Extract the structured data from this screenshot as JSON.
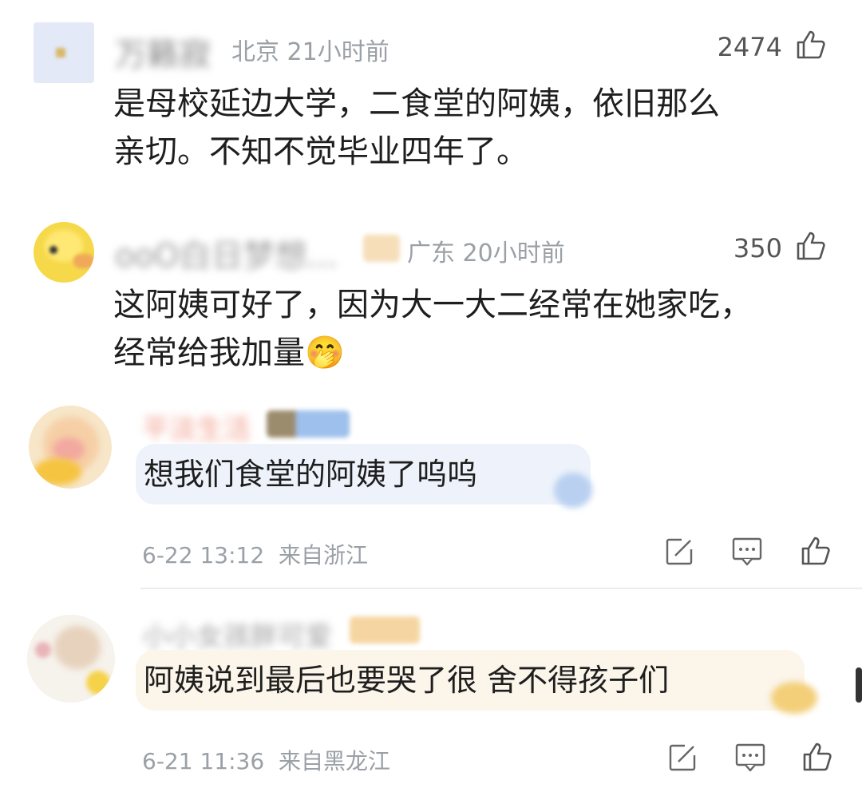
{
  "comments": [
    {
      "username": "万籁寂",
      "location": "北京",
      "time": "21小时前",
      "likes": "2474",
      "text_line1": "是母校延边大学，二食堂的阿姨，依旧那么",
      "text_line2": "亲切。不知不觉毕业四年了。"
    },
    {
      "username": "ooO白日梦想...",
      "location": "广东",
      "time": "20小时前",
      "likes": "350",
      "text_line1": "这阿姨可好了，因为大一大二经常在她家吃，",
      "text_line2": "经常给我加量",
      "emoji": "🤭"
    }
  ],
  "replies": [
    {
      "username": "平淡生活",
      "text": "想我们食堂的阿姨了呜呜",
      "date": "6-22 13:12",
      "source": "来自浙江"
    },
    {
      "username": "小小女孩胖可爱",
      "text": "阿姨说到最后也要哭了很 舍不得孩子们",
      "date": "6-21 11:36",
      "source": "来自黑龙江"
    }
  ],
  "colors": {
    "bubble1": "#eef3fb",
    "bubble2": "#fbf5ea",
    "meta": "#9aa0a6"
  },
  "icons": [
    "like-icon",
    "share-icon",
    "comment-icon"
  ]
}
